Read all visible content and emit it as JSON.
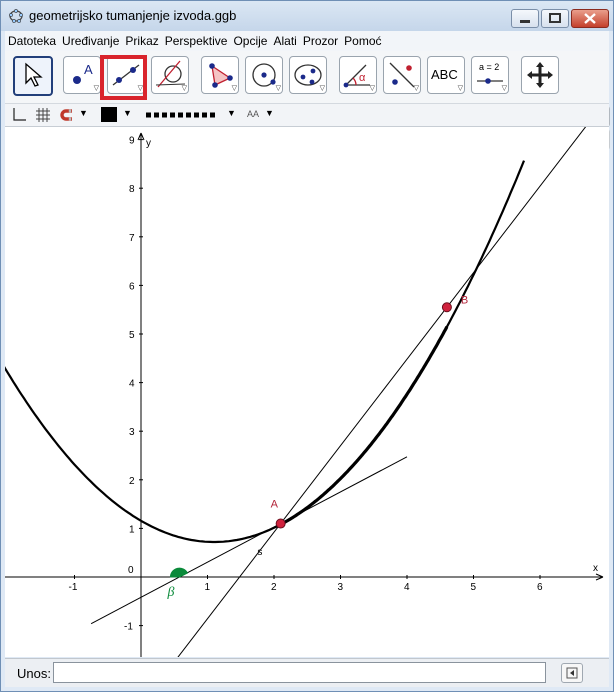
{
  "window": {
    "title": "geometrijsko tumanjenje izvoda.ggb"
  },
  "menu": [
    "Datoteka",
    "Uređivanje",
    "Prikaz",
    "Perspektive",
    "Opcije",
    "Alati",
    "Prozor",
    "Pomoć"
  ],
  "toolbar": {
    "text_tool_label": "ABC",
    "slider_tool_label": "a = 2",
    "angle_tool_label": "α"
  },
  "stylebar": {
    "font_size_label": "AA"
  },
  "graph": {
    "axis_x_label": "x",
    "axis_y_label": "y",
    "origin_label": "0",
    "x_ticks": [
      "-1",
      "1",
      "2",
      "3",
      "4",
      "5",
      "6"
    ],
    "y_ticks": [
      "-1",
      "1",
      "2",
      "3",
      "4",
      "5",
      "6",
      "7",
      "8",
      "9"
    ],
    "points": [
      {
        "label": "A",
        "x": 2.1,
        "y": 1.1
      },
      {
        "label": "B",
        "x": 4.6,
        "y": 5.55
      }
    ],
    "secant_label": "s",
    "angle_label": "β",
    "colors": {
      "point": "#d0223d",
      "point_label": "#b3243a",
      "angle": "#0a8a3a",
      "curve": "#000000"
    }
  },
  "input_bar": {
    "label": "Unos:",
    "value": ""
  }
}
